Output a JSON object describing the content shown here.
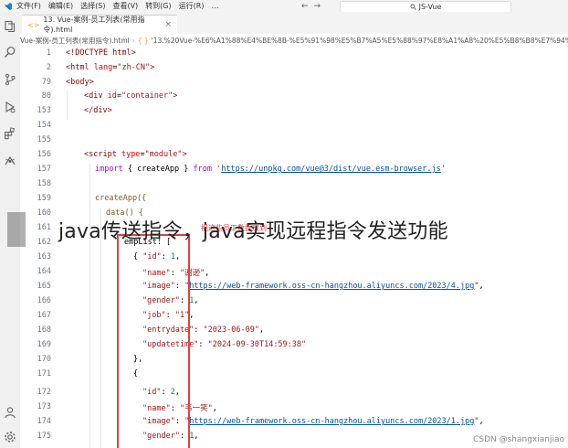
{
  "menubar": {
    "items": [
      "文件(F)",
      "编辑(E)",
      "选择(S)",
      "查看(V)",
      "转到(G)",
      "运行(R)",
      "…"
    ],
    "search_text": "JS-Vue"
  },
  "activitybar": {
    "icons": [
      "explorer-icon",
      "search-icon",
      "source-control-icon",
      "run-debug-icon",
      "extensions-icon",
      "remote-icon",
      "account-icon",
      "settings-icon"
    ]
  },
  "tab": {
    "label": "13. Vue-案例-员工列表(常用指令).html",
    "close": "×"
  },
  "breadcrumb": {
    "folder": "Vue-案例-员工列表(常用指令).html",
    "curly": "{ }",
    "path": "'13.%20Vue-%E6%A1%88%E4%BE%8B-%E5%91%98%E5%B7%A5%E5%88%97%E8%A1%A8%20%E5%B8%B8%E7%94%A8%E6%8C%87"
  },
  "line_numbers": [
    "1",
    "2",
    "79",
    "80",
    "153",
    "154",
    "155",
    "156",
    "157",
    "158",
    "159",
    "160",
    "161",
    "162",
    "163",
    "164",
    "165",
    "166",
    "167",
    "168",
    "169",
    "170",
    "171",
    "172",
    "173",
    "174",
    "175"
  ],
  "code": {
    "doctype": "<!DOCTYPE html>",
    "html_open_a": "<html ",
    "html_attr": "lang",
    "html_eq": "=",
    "html_val": "\"zh-CN\"",
    "html_close": ">",
    "body": "<body>",
    "div_open": "<div ",
    "div_attr": "id",
    "div_val": "\"container\"",
    "div_gt": ">",
    "div_close": "</div>",
    "script_open": "<script ",
    "script_attr": "type",
    "script_val": "\"module\"",
    "script_gt": ">",
    "import_kw": "import",
    "import_body": " { createApp } ",
    "from_kw": "from",
    "import_url": "https://unpkg.com/vue@3/dist/vue.esm-browser.js",
    "import_end": "'",
    "createapp": "createApp({",
    "data_fn": "data() {",
    "emps_line": "empList: [",
    "brace_open": "{ ",
    "id_key": "\"id\"",
    "id_val_1": "1",
    "name_key": "\"name\"",
    "name_val_1": "\"谢逊\"",
    "image_key": "\"image\"",
    "image_url_1": "https://web-framework.oss-cn-hangzhou.aliyuncs.com/2023/4.jpg",
    "gender_key": "\"gender\"",
    "gender_val_1": "1",
    "job_key": "\"job\"",
    "job_val_1": "\"1\"",
    "entry_key": "\"entrydate\"",
    "entry_val_1": "\"2023-06-09\"",
    "update_key": "\"updatetime\"",
    "update_val_1": "\"2024-09-30T14:59:38\"",
    "close_obj": "},",
    "open_obj": "{",
    "id_val_2": "2",
    "name_val_2": "\"韦一笑\"",
    "image_url_2": "https://web-framework.oss-cn-hangzhou.aliyuncs.com/2023/1.jpg",
    "gender_val_2": "1"
  },
  "annotation": {
    "label": "把这些员工数据放到"
  },
  "banner": {
    "title": "java传送指令，java实现远程指令发送功能"
  },
  "watermark": "CSDN @shangxianjiao"
}
